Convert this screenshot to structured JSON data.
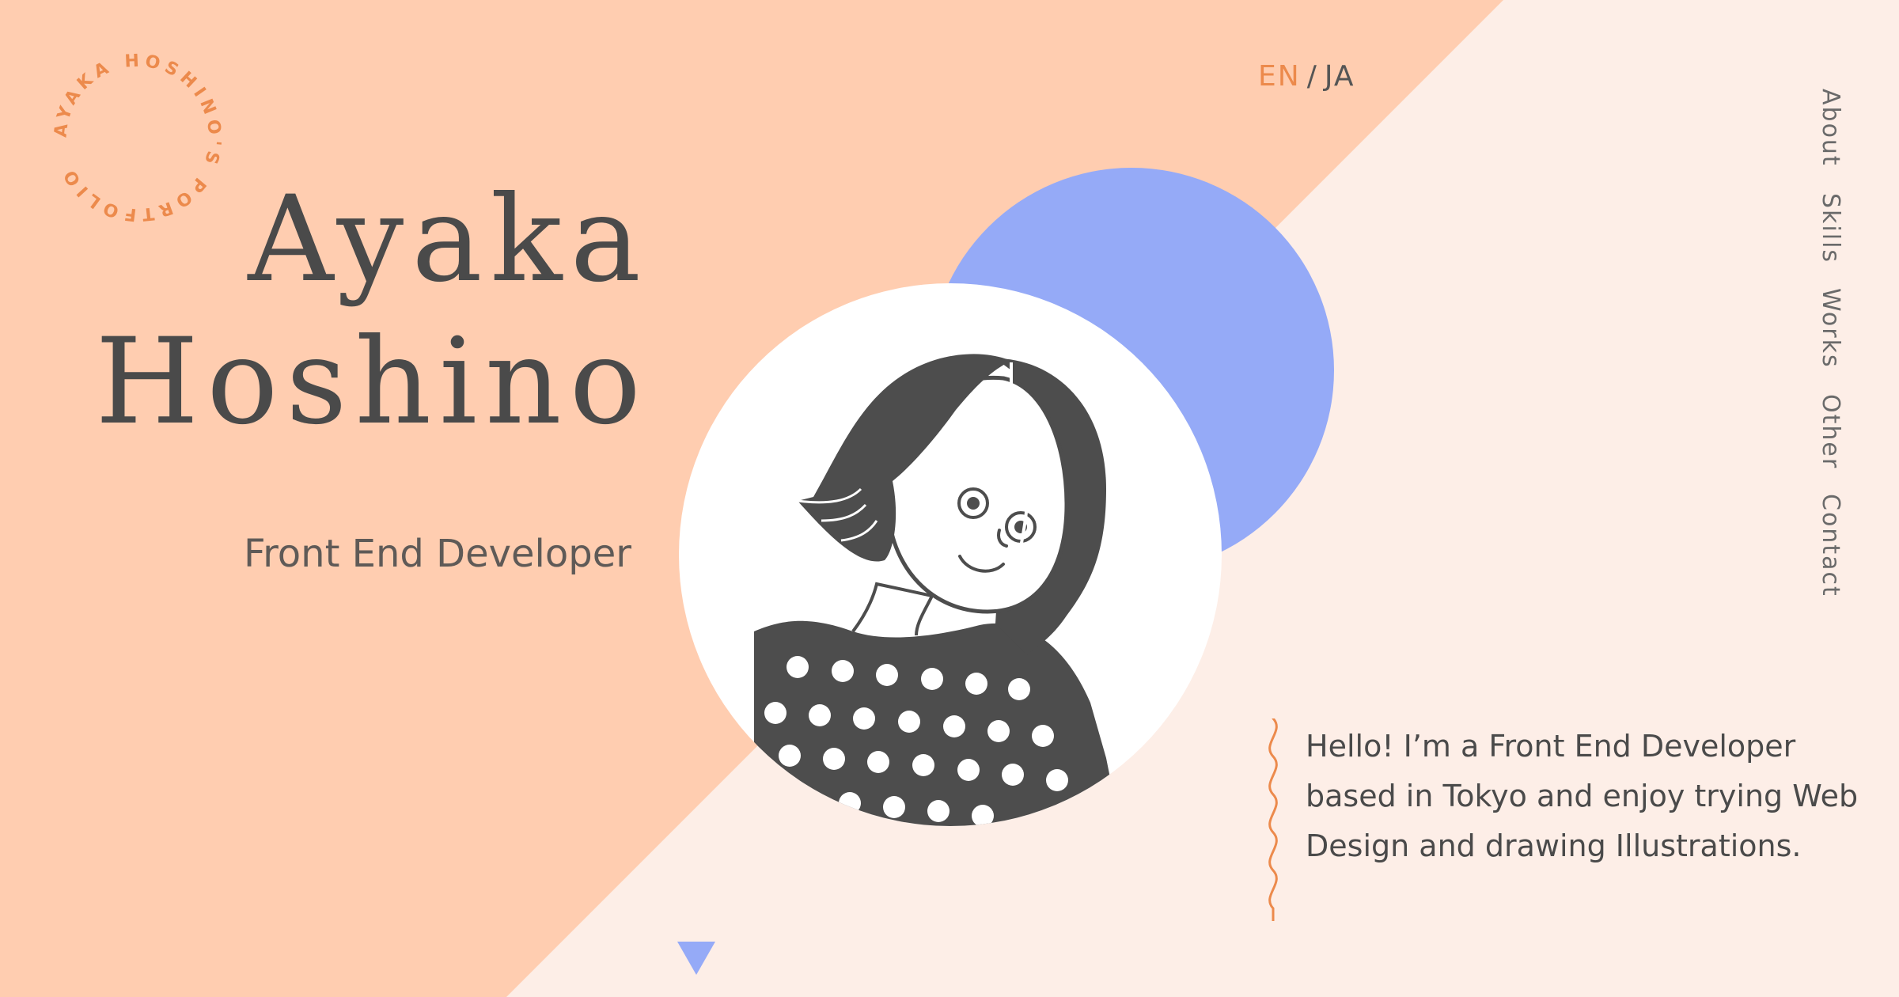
{
  "seal": {
    "text": "AYAKA HOSHINO'S PORTFOLIO"
  },
  "hero": {
    "first_name": "Ayaka",
    "last_name": "Hoshino",
    "role": "Front End Developer"
  },
  "language": {
    "en": "EN",
    "separator": "/",
    "ja": "JA"
  },
  "nav": {
    "items": [
      "About",
      "Skills",
      "Works",
      "Other",
      "Contact"
    ]
  },
  "intro": {
    "text": "Hello! I’m a Front End Developer based in Tokyo and enjoy trying Web Design and drawing Illustrations."
  },
  "icons": {
    "scroll": "triangle-down-icon",
    "divider": "squiggle-icon",
    "portrait": "avatar-illustration"
  },
  "colors": {
    "peach": "#ffcdb0",
    "cream": "#fdeee7",
    "blue": "#95aaf7",
    "orange": "#ec8a4c",
    "text": "#4a4a4a"
  }
}
